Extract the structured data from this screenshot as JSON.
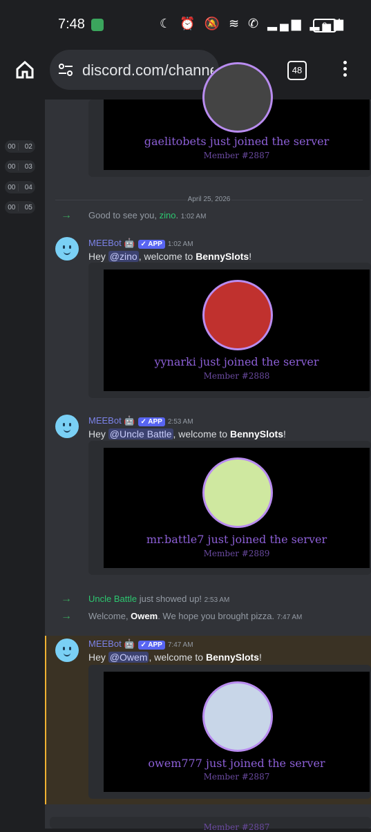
{
  "status": {
    "time": "7:48",
    "battery": "3",
    "tabs_count": "48"
  },
  "browser": {
    "url": "discord.com/channe"
  },
  "left": {
    "pills": [
      [
        "00",
        "02"
      ],
      [
        "00",
        "03"
      ],
      [
        "00",
        "04"
      ],
      [
        "00",
        "05"
      ]
    ]
  },
  "date_separator": "April 25, 2026",
  "messages": {
    "top_join": {
      "text": "gaelitobets just joined the server",
      "member": "Member #2887"
    },
    "sys1": {
      "pre": "Good to see you, ",
      "user": "zino",
      "post": ".",
      "time": "1:02 AM"
    },
    "m1": {
      "name": "MEEBot",
      "badge": "✓ APP",
      "time": "1:02 AM",
      "hey": "Hey ",
      "mention": "@zino",
      "mid": ", welcome to ",
      "server": "BennySlots",
      "end": "!",
      "join": "yynarki just joined the server",
      "member": "Member #2888"
    },
    "m2": {
      "name": "MEEBot",
      "badge": "✓ APP",
      "time": "2:53 AM",
      "hey": "Hey ",
      "mention": "@Uncle Battle",
      "mid": ", welcome to ",
      "server": "BennySlots",
      "end": "!",
      "join": "mr.battle7 just joined the server",
      "member": "Member #2889"
    },
    "sys2": {
      "user": "Uncle Battle",
      "post": " just showed up!",
      "time": "2:53 AM"
    },
    "sys3": {
      "pre": "Welcome, ",
      "user": "Owem",
      "post": ". We hope you brought pizza.",
      "time": "7:47 AM"
    },
    "m3": {
      "name": "MEEBot",
      "badge": "✓ APP",
      "time": "7:47 AM",
      "hey": "Hey ",
      "mention": "@Owem",
      "mid": ", welcome to ",
      "server": "BennySlots",
      "end": "!",
      "join": "owem777 just joined the server",
      "member": "Member #2887"
    },
    "bottom_partial": "Member #2887"
  }
}
